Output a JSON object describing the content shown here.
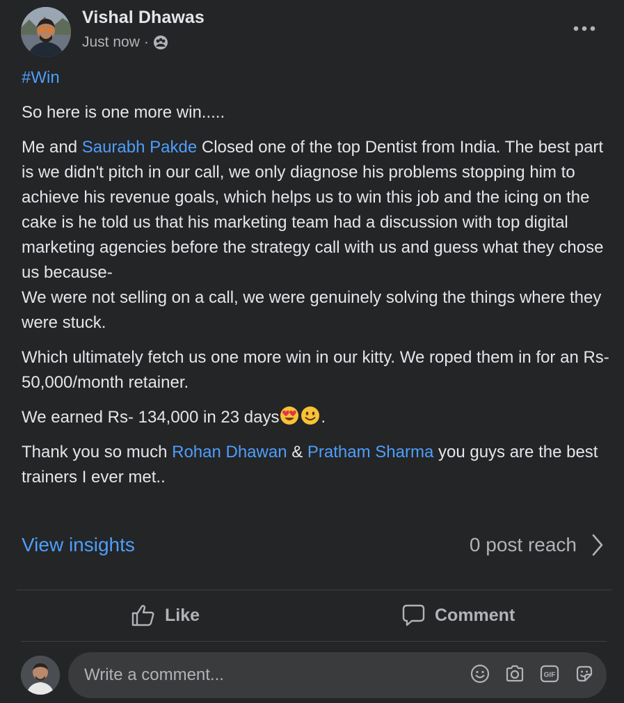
{
  "author": {
    "name": "Vishal Dhawas",
    "time": "Just now",
    "separator": "·",
    "audience_icon": "group-audience-icon"
  },
  "post": {
    "hashtag": "#Win",
    "p1": "So here is one more win.....",
    "p2_prefix": "Me and ",
    "p2_mention": "Saurabh Pakde",
    "p2_rest": " Closed one of the top Dentist from India. The best part is we didn't pitch in our call, we only diagnose his problems stopping him to achieve his revenue goals, which helps us to win this job and the icing on the cake is he told us that his marketing team had a discussion with top digital marketing agencies before the strategy call with us and guess what they chose us because-",
    "p2_line2": "We were not selling on a call, we were genuinely solving the things where they were stuck.",
    "p3": "Which ultimately fetch us one more win in our kitty. We roped them in for an Rs- 50,000/month retainer.",
    "p4_text": "We earned Rs- 134,000 in 23 days",
    "p4_end": ".",
    "p5_prefix": "Thank you so much ",
    "p5_mention1": "Rohan Dhawan",
    "p5_and": " & ",
    "p5_mention2": "Pratham Sharma",
    "p5_suffix": " you guys are the best trainers I ever met.."
  },
  "insights": {
    "view_label": "View insights",
    "reach_label": "0 post reach"
  },
  "actions": {
    "like_label": "Like",
    "comment_label": "Comment"
  },
  "comment": {
    "placeholder": "Write a comment..."
  },
  "colors": {
    "background": "#242526",
    "link": "#4e9efd",
    "text": "#e4e6eb",
    "muted": "#b0b3b8"
  }
}
